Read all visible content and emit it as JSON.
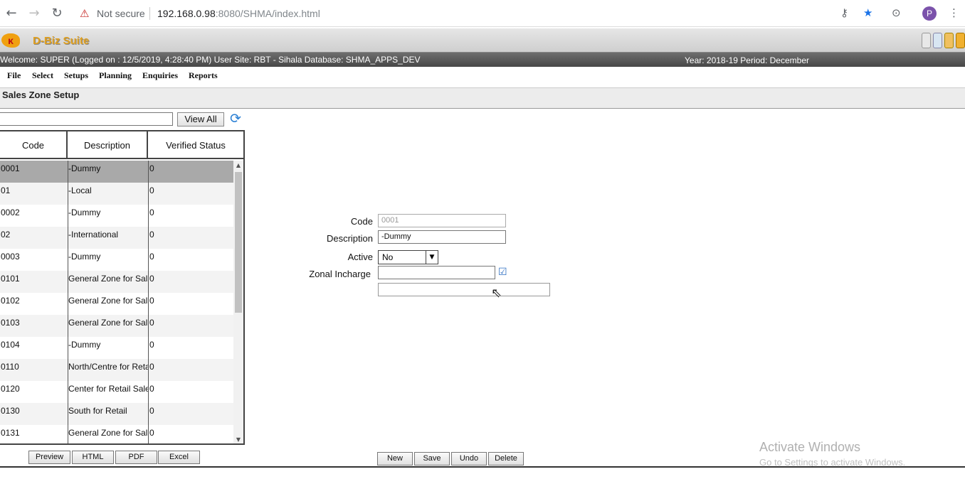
{
  "browser": {
    "warning": "Not secure",
    "url_host": "192.168.0.98",
    "url_path": ":8080/SHMA/index.html",
    "avatar_letter": "P"
  },
  "app": {
    "logo_text": "D-Biz Suite",
    "welcome": "Welcome: SUPER (Logged on : 12/5/2019, 4:28:40 PM) User Site: RBT - Sihala Database: SHMA_APPS_DEV",
    "period": "Year: 2018-19 Period: December"
  },
  "menu": [
    "File",
    "Select",
    "Setups",
    "Planning",
    "Enquiries",
    "Reports"
  ],
  "page_title": "Sales Zone Setup",
  "search": {
    "value": "",
    "view_all": "View All"
  },
  "grid": {
    "headers": [
      "Code",
      "Description",
      "Verified Status"
    ],
    "rows": [
      {
        "code": "0001",
        "desc": "-Dummy",
        "status": "0",
        "selected": true
      },
      {
        "code": "01",
        "desc": "-Local",
        "status": "0"
      },
      {
        "code": "0002",
        "desc": "-Dummy",
        "status": "0"
      },
      {
        "code": "02",
        "desc": "-International",
        "status": "0"
      },
      {
        "code": "0003",
        "desc": "-Dummy",
        "status": "0"
      },
      {
        "code": "0101",
        "desc": "General Zone for Sal",
        "status": "0"
      },
      {
        "code": "0102",
        "desc": "General Zone for Sal",
        "status": "0"
      },
      {
        "code": "0103",
        "desc": "General Zone for Sal",
        "status": "0"
      },
      {
        "code": "0104",
        "desc": "-Dummy",
        "status": "0"
      },
      {
        "code": "0110",
        "desc": "North/Centre for Reta",
        "status": "0"
      },
      {
        "code": "0120",
        "desc": "Center for Retail Sale",
        "status": "0"
      },
      {
        "code": "0130",
        "desc": "South for Retail",
        "status": "0"
      },
      {
        "code": "0131",
        "desc": "General Zone for Sal",
        "status": "0"
      }
    ]
  },
  "export_buttons": [
    "Preview",
    "HTML",
    "PDF",
    "Excel"
  ],
  "form": {
    "code_label": "Code",
    "code_value": "0001",
    "description_label": "Description",
    "description_value": "-Dummy",
    "active_label": "Active",
    "active_value": "No",
    "zonal_label": "Zonal Incharge",
    "zonal_value": "",
    "zonal_name": ""
  },
  "actions": [
    "New",
    "Save",
    "Undo",
    "Delete"
  ],
  "watermark": {
    "line1": "Activate Windows",
    "line2": "Go to Settings to activate Windows."
  }
}
